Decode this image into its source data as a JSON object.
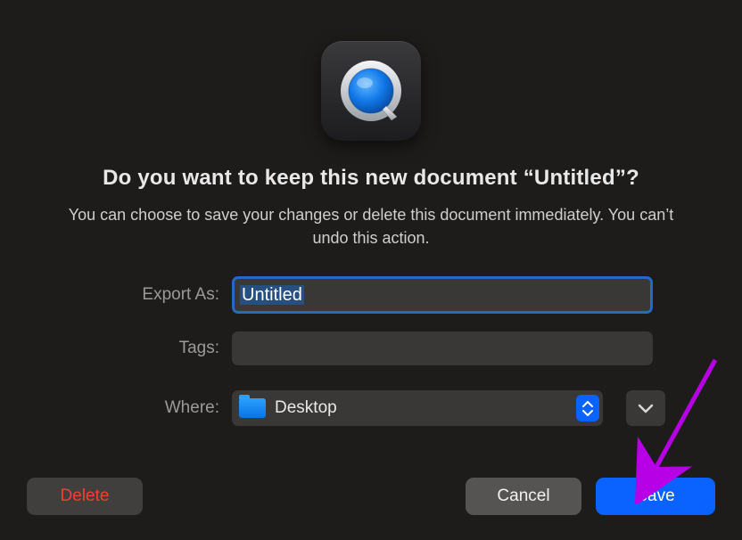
{
  "dialog": {
    "heading": "Do you want to keep this new document “Untitled”?",
    "subheading": "You can choose to save your changes or delete this document immediately. You can’t undo this action."
  },
  "form": {
    "export_as_label": "Export As:",
    "export_as_value": "Untitled",
    "tags_label": "Tags:",
    "tags_value": "",
    "where_label": "Where:",
    "where_value": "Desktop"
  },
  "buttons": {
    "delete": "Delete",
    "cancel": "Cancel",
    "save": "Save"
  },
  "icons": {
    "app": "quicktime-icon",
    "folder": "folder-icon",
    "stepper": "updown-chevron-icon",
    "disclose": "chevron-down-icon"
  },
  "colors": {
    "accent": "#0a63ff",
    "destructive": "#ff3b30",
    "annotation": "#b800e6"
  }
}
